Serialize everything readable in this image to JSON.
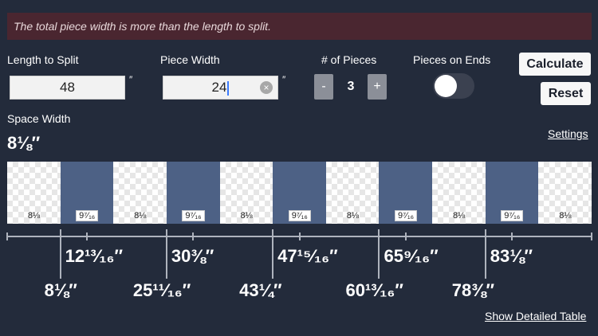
{
  "alert": {
    "message": "The total piece width is more than the length to split."
  },
  "inputs": {
    "length_label": "Length to Split",
    "length_value": "48",
    "length_unit": "″",
    "piece_width_label": "Piece Width",
    "piece_width_value": "24",
    "piece_width_unit": "″",
    "pieces_label": "# of Pieces",
    "pieces_value": "3",
    "minus_label": "-",
    "plus_label": "+",
    "ends_label": "Pieces on Ends",
    "ends_on": false
  },
  "buttons": {
    "calculate": "Calculate",
    "reset": "Reset"
  },
  "space_width": {
    "label": "Space Width",
    "value": "8⅛″"
  },
  "links": {
    "settings": "Settings",
    "detail_table": "Show Detailed Table"
  },
  "segments": [
    {
      "type": "space",
      "label": "8⅛"
    },
    {
      "type": "piece",
      "label": "9⁷⁄₁₆"
    },
    {
      "type": "space",
      "label": "8⅛"
    },
    {
      "type": "piece",
      "label": "9⁷⁄₁₆"
    },
    {
      "type": "space",
      "label": "8⅛"
    },
    {
      "type": "piece",
      "label": "9⁷⁄₁₆"
    },
    {
      "type": "space",
      "label": "8⅛"
    },
    {
      "type": "piece",
      "label": "9⁷⁄₁₆"
    },
    {
      "type": "space",
      "label": "8⅛"
    },
    {
      "type": "piece",
      "label": "9⁷⁄₁₆"
    },
    {
      "type": "space",
      "label": "8⅛"
    }
  ],
  "center_marks": [
    "12¹³⁄₁₆″",
    "30⅜″",
    "47¹⁵⁄₁₆″",
    "65⁹⁄₁₆″",
    "83⅛″"
  ],
  "edge_marks": [
    "8⅛″",
    "25¹¹⁄₁₆″",
    "43¼″",
    "60¹³⁄₁₆″",
    "78⅜″"
  ],
  "colors": {
    "background": "#232b3b",
    "piece": "#4d6185",
    "alert_bg": "#4a2630"
  }
}
